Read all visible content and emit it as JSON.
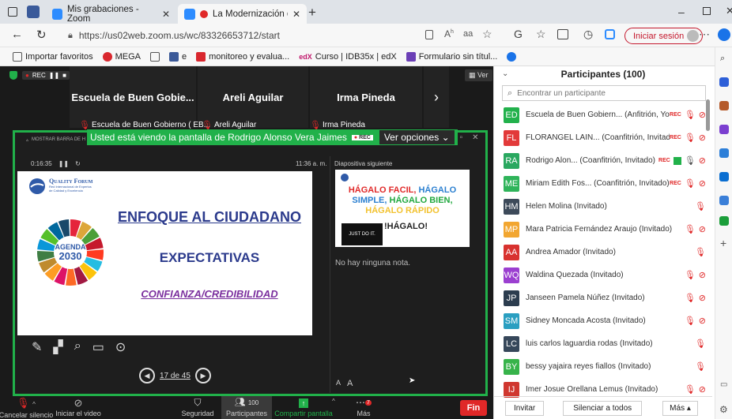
{
  "browser": {
    "tabs": [
      {
        "label": "Mis grabaciones - Zoom"
      },
      {
        "label": "La Modernización del Estad"
      }
    ],
    "new_tab": "+",
    "url": "https://us02web.zoom.us/wc/83326653712/start",
    "reader_text": "aa",
    "signin_label": "Iniciar sesión",
    "favorites": [
      {
        "label": "Importar favoritos"
      },
      {
        "label": "MEGA"
      },
      {
        "label": ""
      },
      {
        "label": "e"
      },
      {
        "label": "monitoreo y evalua..."
      },
      {
        "label": "Curso | IDB35x | edX"
      },
      {
        "label": "Formulario sin títul..."
      }
    ]
  },
  "zoom": {
    "rec_label": "REC",
    "view_label": "Ver",
    "participant_tiles": [
      {
        "name": "Escuela de Buen Gobie...",
        "sub": "Escuela de Buen Gobierno ( EB..."
      },
      {
        "name": "Areli Aguilar",
        "sub": "Areli Aguilar"
      },
      {
        "name": "Irma Pineda",
        "sub": "Irma Pineda"
      }
    ],
    "banner_text": "Usted está viendo la pantalla de Rodrigo Alonso Vera Jaimes",
    "banner_rec": "REC",
    "view_options": "Ver opciones",
    "share_toolbar_text": "MOSTRAR BARRA DE H",
    "timer": "0:16:35",
    "clock": "11:36 a. m.",
    "next_slide_label": "Diapositiva siguiente",
    "notes_text": "No hay ninguna nota.",
    "slide": {
      "logo_text": "Quality Forum",
      "logo_sub": "Red Internacional de Expertos de Calidad y Excelencia",
      "agenda_line1": "AGENDA",
      "agenda_line2": "2030",
      "title": "ENFOQUE AL CIUDADANO",
      "subtitle": "EXPECTATIVAS",
      "tagline": "CONFIANZA/CREDIBILIDAD"
    },
    "next_slide": {
      "line1": "HÁGALO FACIL,",
      "line1b": "HÁGALO",
      "line2": "SIMPLE,",
      "line2b": "HÁGALO BIEN,",
      "line3": "HÁGALO RÁPIDO",
      "line4": "!HÁGALO!",
      "justdoit": "JUST DO IT."
    },
    "page_indicator": "17 de 45",
    "font_small": "A",
    "font_large": "A",
    "controls": [
      {
        "label": "Cancelar silencio"
      },
      {
        "label": "Iniciar el video"
      },
      {
        "label": "Seguridad"
      },
      {
        "label": "Participantes",
        "count": "100"
      },
      {
        "label": "Compartir pantalla"
      },
      {
        "label": "Más",
        "badge": "7"
      }
    ],
    "end_label": "Fin"
  },
  "participants": {
    "title": "Participantes (100)",
    "search_placeholder": "Encontrar un participante",
    "rec": "REC",
    "list": [
      {
        "initials": "ED",
        "name": "Escuela de Buen Gobiern... (Anfitrión, Yo)",
        "color": "#22b14c"
      },
      {
        "initials": "FL",
        "name": "FLORANGEL LAIN... (Coanfitrión, Invitado)",
        "color": "#e23a3a"
      },
      {
        "initials": "RA",
        "name": "Rodrigo Alon... (Coanfitrión, Invitado)",
        "color": "#2aa860"
      },
      {
        "initials": "ME",
        "name": "Miriam Edith Fos... (Coanfitrión, Invitado)",
        "color": "#2fb45a"
      },
      {
        "initials": "HM",
        "name": "Helen Molina (Invitado)",
        "color": "#3d4a5a"
      },
      {
        "initials": "MP",
        "name": "Mara Patricia Fernández Araujo (Invitado)",
        "color": "#f2a630"
      },
      {
        "initials": "AA",
        "name": "Andrea Amador (Invitado)",
        "color": "#d8322f"
      },
      {
        "initials": "WQ",
        "name": "Waldina Quezada (Invitado)",
        "color": "#9b3fd0"
      },
      {
        "initials": "JP",
        "name": "Janseen Pamela Núñez (Invitado)",
        "color": "#2c3d4f"
      },
      {
        "initials": "SM",
        "name": "Sidney Moncada Acosta (Invitado)",
        "color": "#2a9fc1"
      },
      {
        "initials": "LC",
        "name": "luis carlos laguardia rodas (Invitado)",
        "color": "#36475a"
      },
      {
        "initials": "BY",
        "name": "bessy yajaira reyes fiallos (Invitado)",
        "color": "#37b34a"
      },
      {
        "initials": "IJ",
        "name": "Imer Josue Orellana Lemus (Invitado)",
        "color": "#d0372f"
      }
    ],
    "invite_label": "Invitar",
    "mute_all_label": "Silenciar a todos",
    "more_label": "Más"
  }
}
